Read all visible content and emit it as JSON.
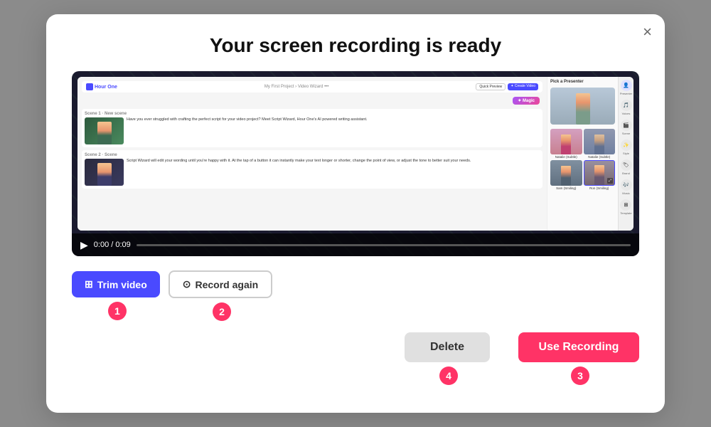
{
  "modal": {
    "title": "Your screen recording is ready",
    "close_label": "×"
  },
  "app_embed": {
    "logo": "Hour One",
    "breadcrumb": "My First Project › Video Wizard  •••",
    "preview_btn": "Quick Preview",
    "create_btn": "✦ Create Video",
    "magic_btn": "✦ Magic",
    "scene1_label": "Scene 1 · New scene",
    "scene1_text": "Have you ever struggled with crafting the perfect script for your video project? Meet Script Wizard, Hour One's AI powered writing assistant.",
    "scene2_label": "Scene 2 · Scene",
    "scene2_text": "Script Wizard will edit your wording until you're happy with it. At the tap of a button it can instantly make your text longer or shorter, change the point of view, or adjust the tone to better suit your needs.",
    "right_label": "Pick a Presenter",
    "presenters": [
      {
        "name": "",
        "color1": "#c8a882",
        "color2": "#8ba0b0",
        "selected": false
      },
      {
        "name": "",
        "color1": "#e8956d",
        "color2": "#b87060",
        "selected": false
      },
      {
        "name": "Natalie (Subtle)",
        "color1": "#d4a0b0",
        "color2": "#c08090",
        "selected": false
      },
      {
        "name": "Natalie (Subtle)",
        "color1": "#9098b0",
        "color2": "#7080a0",
        "selected": false
      },
      {
        "name": "Sam (Smiling)",
        "color1": "#8090a0",
        "color2": "#607080",
        "selected": false
      },
      {
        "name": "Ron (Smiling)",
        "color1": "#9890a0",
        "color2": "#786870",
        "selected": true
      }
    ],
    "sidebar_items": [
      "Presenter",
      "Voices",
      "Scene",
      "Style",
      "Brand",
      "Music",
      "Template"
    ]
  },
  "video_controls": {
    "time": "0:00 / 0:09"
  },
  "actions": {
    "trim_icon": "⊞",
    "trim_label": "Trim video",
    "record_icon": "⊙",
    "record_again_label": "Record again",
    "badge1": "1",
    "badge2": "2",
    "badge3": "3",
    "badge4": "4"
  },
  "bottom": {
    "delete_label": "Delete",
    "use_recording_label": "Use Recording"
  }
}
